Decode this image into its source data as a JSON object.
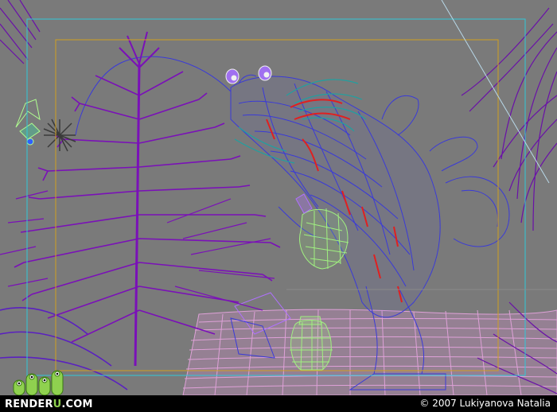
{
  "branding": {
    "site_prefix": "RENDER",
    "site_accent": "U",
    "site_suffix": ".COM",
    "accent_color": "#8fd14f"
  },
  "credit": {
    "text": "© 2007 Lukiyanova Natalia"
  },
  "viewport": {
    "background": "#7a7a7a",
    "safe_frame_color": "#d0a020",
    "camera_frame_color": "#30c8d8",
    "wire_colors": {
      "plant": "#7a10b8",
      "creature": "#3a3ad8",
      "creature_accent": "#e02020",
      "hair": "#20a0a0",
      "ground": "#f0a8e8",
      "lantern": "#a0f080",
      "fairy": "#b0ff90"
    }
  }
}
